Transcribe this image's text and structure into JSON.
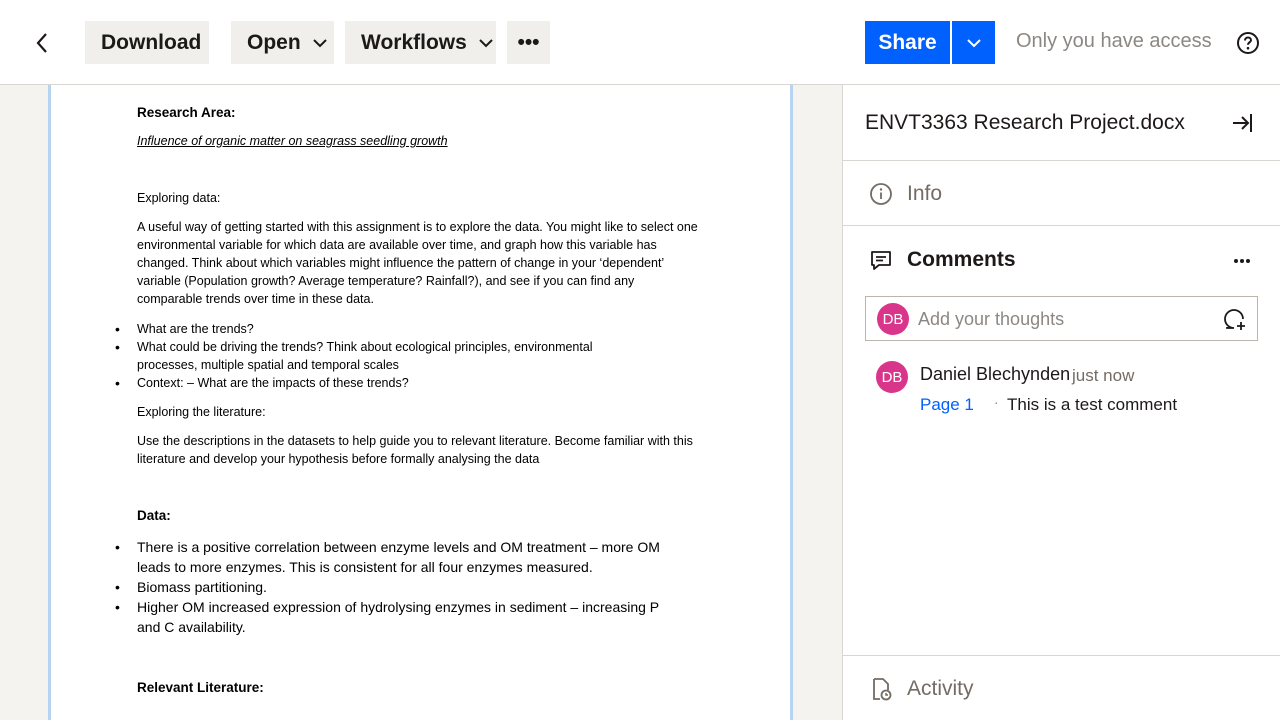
{
  "toolbar": {
    "download_label": "Download",
    "open_label": "Open",
    "workflows_label": "Workflows",
    "more_label": "•••",
    "share_label": "Share",
    "access_text": "Only you have access"
  },
  "document": {
    "research_area_heading": "Research Area:",
    "research_area_title": "Influence of organic matter on seagrass seedling growth",
    "exploring_data_heading": "Exploring data:",
    "exploring_data_para": "A useful way of getting started with this assignment is to explore the data. You might like to select one environmental variable for which data are available over time, and graph how this variable has changed. Think about which variables might influence the pattern of change in your ‘dependent’ variable (Population growth? Average temperature? Rainfall?), and see if you can find any comparable trends over time in these data.",
    "exploring_data_bullets": [
      "What are the trends?",
      "What could be driving the trends? Think about ecological principles, environmental processes, multiple spatial and temporal scales",
      "Context: – What are the impacts of these trends?"
    ],
    "exploring_lit_heading": "Exploring the literature:",
    "exploring_lit_para": "Use the descriptions in the datasets to help guide you to relevant literature. Become familiar with this literature and develop your hypothesis before formally analysing the data",
    "data_heading": "Data:",
    "data_bullets": [
      "There is a positive correlation between enzyme levels and OM treatment – more OM leads to more enzymes. This is consistent for all four enzymes measured.",
      "Biomass partitioning.",
      "Higher OM increased expression of hydrolysing enzymes in sediment – increasing P and C availability."
    ],
    "relevant_lit_heading": "Relevant Literature:"
  },
  "panel": {
    "file_name": "ENVT3363 Research Project.docx",
    "info_label": "Info",
    "comments_label": "Comments",
    "comment_placeholder": "Add your thoughts",
    "user_initials": "DB",
    "comments": [
      {
        "author": "Daniel Blechynden",
        "time": "just now",
        "page": "Page 1",
        "text": "This is a test comment"
      }
    ],
    "activity_label": "Activity"
  },
  "colors": {
    "accent": "#0061fe",
    "avatar": "#d9368b",
    "button_bg": "#f1efec"
  }
}
